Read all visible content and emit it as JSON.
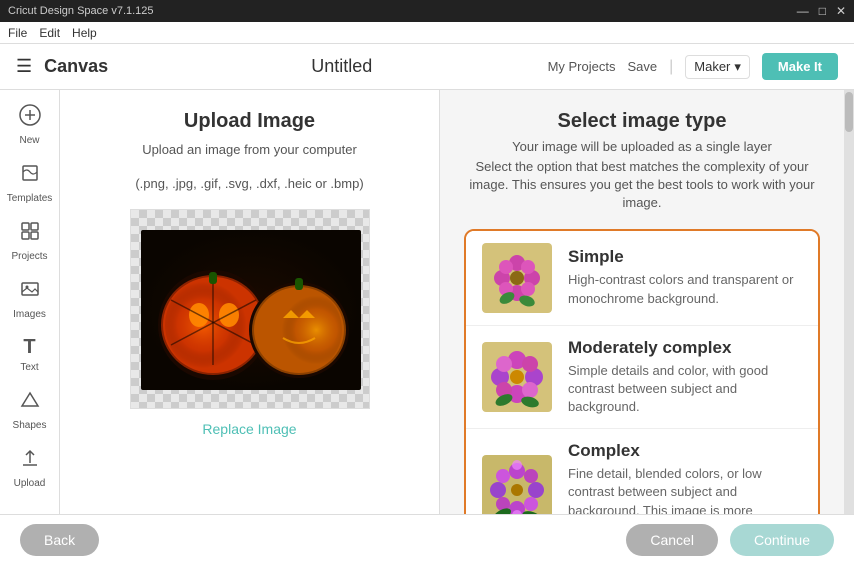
{
  "titleBar": {
    "title": "Cricut Design Space  v7.1.125",
    "minimize": "—",
    "maximize": "□",
    "close": "✕"
  },
  "menuBar": {
    "items": [
      "File",
      "Edit",
      "Help"
    ]
  },
  "header": {
    "hamburgerLabel": "☰",
    "canvasLabel": "Canvas",
    "title": "Untitled",
    "myProjectsLabel": "My Projects",
    "saveLabel": "Save",
    "makerLabel": "Maker",
    "makeItLabel": "Make It"
  },
  "sidebar": {
    "items": [
      {
        "icon": "✚",
        "label": "New"
      },
      {
        "icon": "👕",
        "label": "Templates"
      },
      {
        "icon": "⊞",
        "label": "Projects"
      },
      {
        "icon": "🖼",
        "label": "Images"
      },
      {
        "icon": "T",
        "label": "Text"
      },
      {
        "icon": "⬟",
        "label": "Shapes"
      },
      {
        "icon": "⬆",
        "label": "Upload"
      }
    ]
  },
  "uploadSection": {
    "title": "Upload Image",
    "desc1": "Upload an image from your computer",
    "desc2": "(.png, .jpg, .gif, .svg, .dxf, .heic or .bmp)",
    "replaceImageLabel": "Replace Image"
  },
  "selectSection": {
    "title": "Select image type",
    "subtitle": "Your image will be uploaded as a single layer",
    "desc": "Select the option that best matches the complexity of your image. This ensures you get the best tools to work with your image.",
    "options": [
      {
        "name": "Simple",
        "desc": "High-contrast colors and transparent or monochrome background.",
        "thumbnailColor": "#d4c28a"
      },
      {
        "name": "Moderately complex",
        "desc": "Simple details and color, with good contrast between subject and background.",
        "thumbnailColor": "#d4c28a"
      },
      {
        "name": "Complex",
        "desc": "Fine detail, blended colors, or low contrast between subject and background. This image is more challenging to work with.",
        "thumbnailColor": "#d4c28a"
      }
    ]
  },
  "bottomBar": {
    "backLabel": "Back",
    "cancelLabel": "Cancel",
    "continueLabel": "Continue"
  }
}
